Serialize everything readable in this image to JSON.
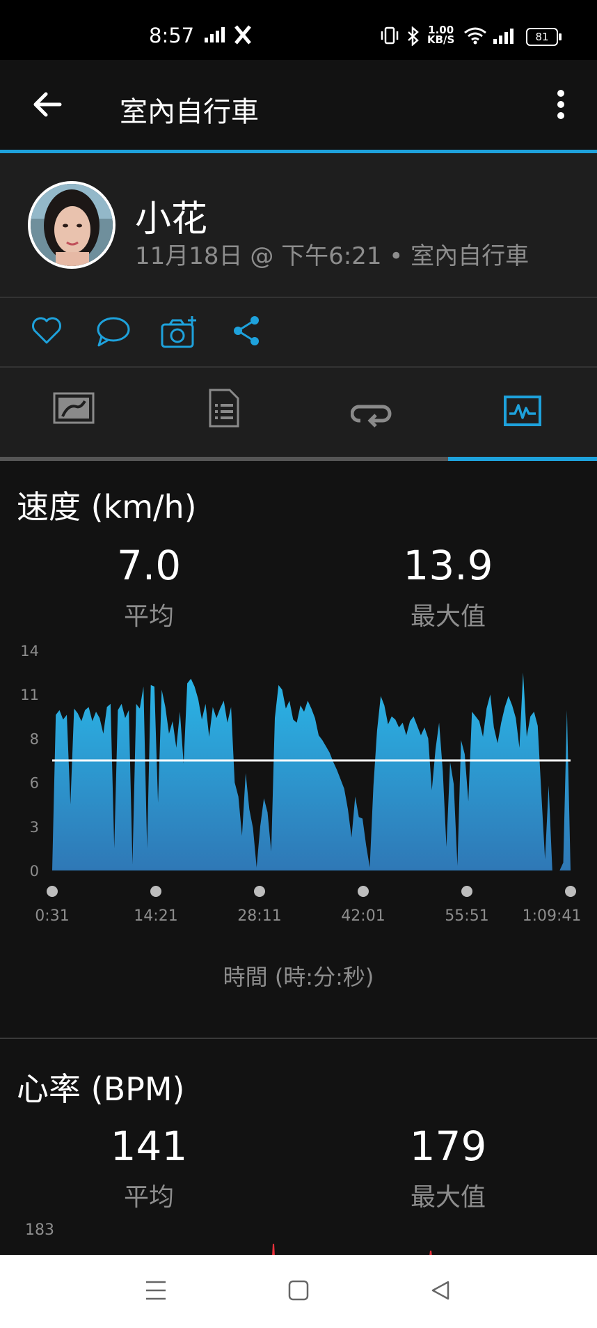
{
  "status_bar": {
    "time": "8:57",
    "net_speed_value": "1.00",
    "net_speed_unit": "KB/S",
    "battery": "81"
  },
  "app_bar": {
    "title": "室內自行車",
    "back_icon": "arrow-left-icon",
    "menu_icon": "more-vert-icon"
  },
  "profile": {
    "name": "小花",
    "meta": "11月18日 @ 下午6:21 • 室內自行車"
  },
  "actions": [
    "heart-icon",
    "comment-icon",
    "add-photo-icon",
    "share-icon"
  ],
  "tabs": [
    {
      "icon": "map-icon"
    },
    {
      "icon": "details-icon"
    },
    {
      "icon": "laps-icon"
    },
    {
      "icon": "charts-icon",
      "active": true
    }
  ],
  "colors": {
    "accent": "#1ea2dc",
    "background": "#121212",
    "panel": "#1e1e1e",
    "muted_text": "#8d8d8d",
    "heart_rate_line": "#e8303a"
  },
  "speed": {
    "title": "速度 (km/h)",
    "avg_value": "7.0",
    "avg_label": "平均",
    "max_value": "13.9",
    "max_label": "最大值",
    "x_axis_title": "時間 (時:分:秒)"
  },
  "heart_rate": {
    "title": "心率 (BPM)",
    "avg_value": "141",
    "avg_label": "平均",
    "max_value": "179",
    "max_label": "最大值",
    "y_top_label": "183"
  },
  "chart_data": {
    "type": "area",
    "title": "速度 (km/h)",
    "xlabel": "時間 (時:分:秒)",
    "ylabel": "",
    "x_ticks": [
      "0:31",
      "14:21",
      "28:11",
      "42:01",
      "55:51",
      "1:09:41"
    ],
    "y_ticks": [
      "0",
      "3",
      "6",
      "8",
      "11",
      "14"
    ],
    "ylim": [
      0,
      14
    ],
    "average": 7.0,
    "series": [
      {
        "values": [
          0,
          9.9,
          10.2,
          9.6,
          9.9,
          4.2,
          10.3,
          10.0,
          9.5,
          10.2,
          10.4,
          9.5,
          10.1,
          9.7,
          8.7,
          10.4,
          10.6,
          1.4,
          10.2,
          10.6,
          9.7,
          10.2,
          0.4,
          10.6,
          10.3,
          11.7,
          1.4,
          11.8,
          11.7,
          4.3,
          11.5,
          10.4,
          8.7,
          9.5,
          7.8,
          10.1,
          6.8,
          11.9,
          12.2,
          11.7,
          10.9,
          9.6,
          10.6,
          8.5,
          10.4,
          9.7,
          10.3,
          10.8,
          9.4,
          10.4,
          5.6,
          4.7,
          2.2,
          6.2,
          3.9,
          2.7,
          0.2,
          2.8,
          4.6,
          3.7,
          1.2,
          9.7,
          11.8,
          11.5,
          10.3,
          10.8,
          9.6,
          9.4,
          10.5,
          10.1,
          10.8,
          10.3,
          9.7,
          8.6,
          8.3,
          7.9,
          7.5,
          6.9,
          6.4,
          5.8,
          5.2,
          3.9,
          2.1,
          4.7,
          3.4,
          3.3,
          1.6,
          0.2,
          5.4,
          8.9,
          11.1,
          10.5,
          9.3,
          9.8,
          9.6,
          9.1,
          9.4,
          8.6,
          9.5,
          9.8,
          9.2,
          8.6,
          9.1,
          8.4,
          5.1,
          7.7,
          9.4,
          6.3,
          1.5,
          6.9,
          5.5,
          0.3,
          8.3,
          7.4,
          4.4,
          10.1,
          9.8,
          9.5,
          8.5,
          10.3,
          11.2,
          9.1,
          8.1,
          9.4,
          10.4,
          11.1,
          10.5,
          9.7,
          7.8,
          12.6,
          8.5,
          9.8,
          10.1,
          9.2,
          4.9,
          0.7,
          5.4,
          0,
          0,
          0,
          0.5,
          10.2,
          0
        ],
        "approximate": true
      }
    ],
    "legend": "none",
    "grid": false
  }
}
